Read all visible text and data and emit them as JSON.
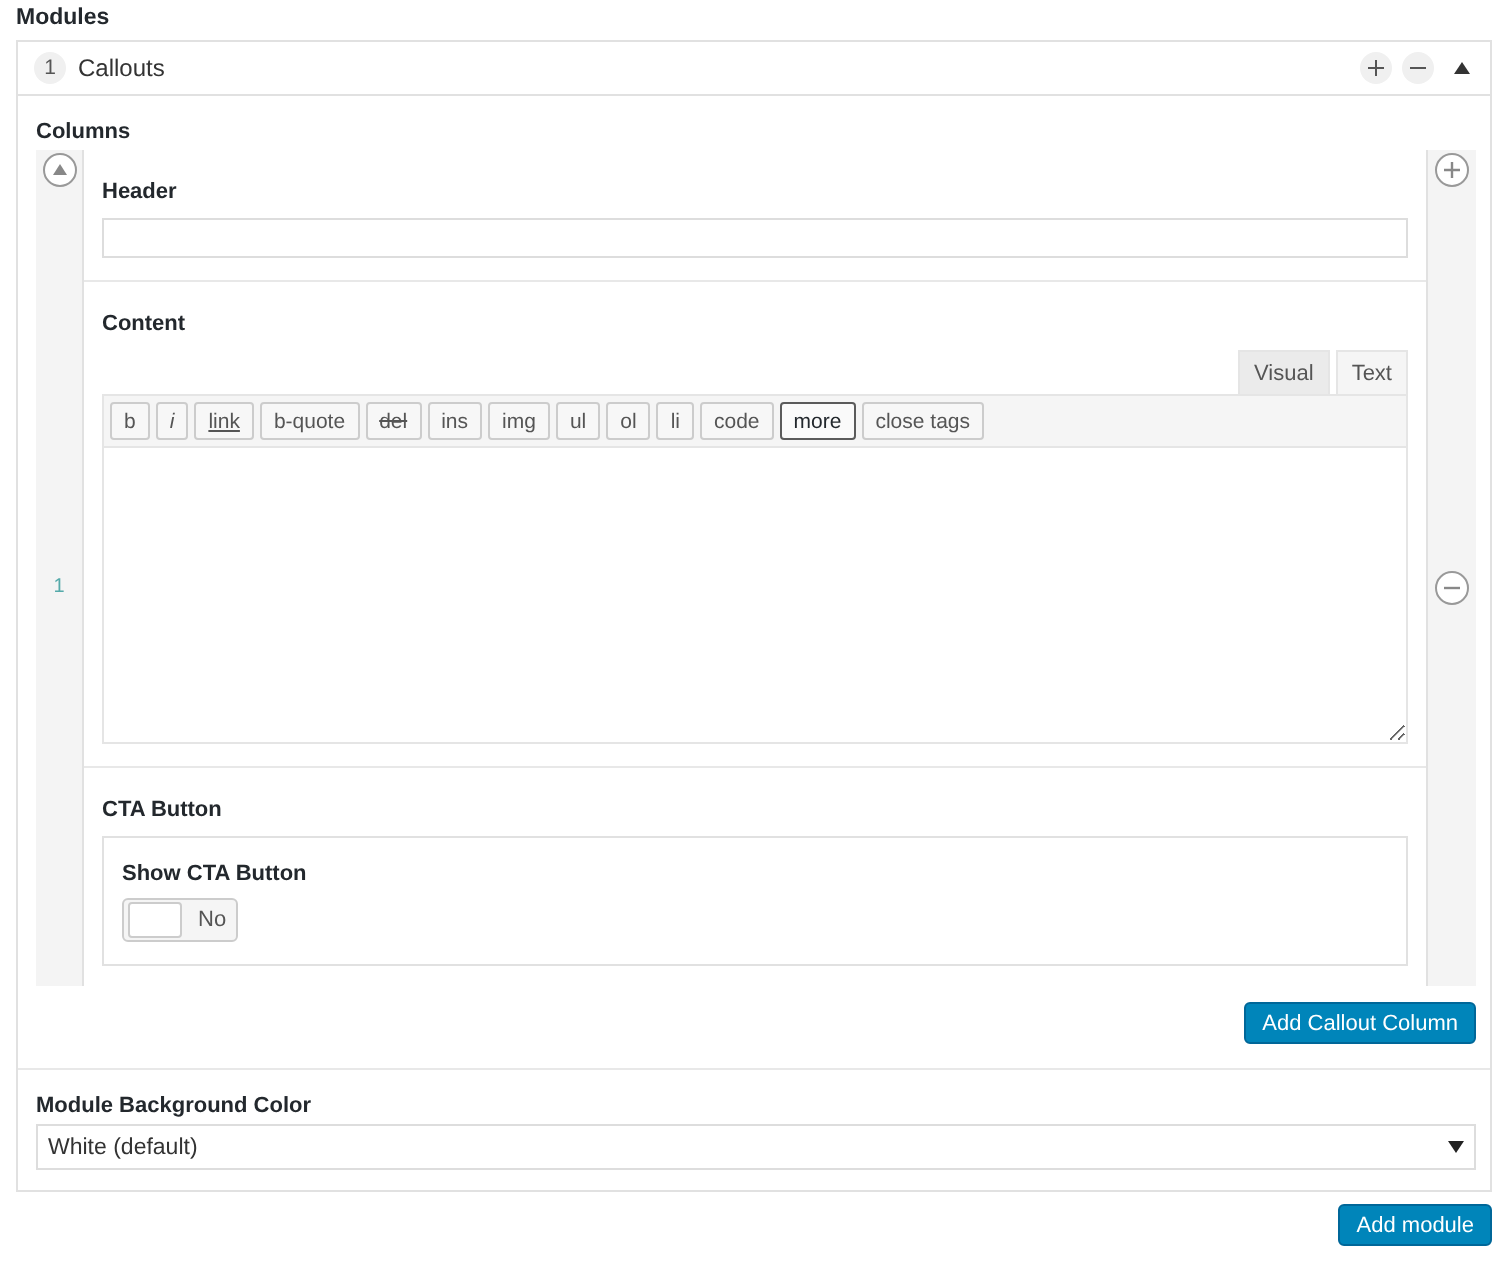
{
  "section_label": "Modules",
  "module": {
    "number": "1",
    "title": "Callouts",
    "expanded": true,
    "columns_label": "Columns",
    "rows": [
      {
        "number": "1",
        "fields": [
          {
            "kind": "text",
            "label": "Header"
          },
          {
            "kind": "editor",
            "label": "Content",
            "tabs": [
              {
                "label": "Visual",
                "selected": false
              },
              {
                "label": "Text",
                "selected": true
              }
            ],
            "buttons": [
              {
                "label": "b",
                "kind": "plain",
                "focused": false
              },
              {
                "label": "i",
                "kind": "italic",
                "focused": false
              },
              {
                "label": "link",
                "kind": "underline",
                "focused": false
              },
              {
                "label": "b-quote",
                "kind": "plain",
                "focused": false
              },
              {
                "label": "del",
                "kind": "strike",
                "focused": false
              },
              {
                "label": "ins",
                "kind": "plain",
                "focused": false
              },
              {
                "label": "img",
                "kind": "plain",
                "focused": false
              },
              {
                "label": "ul",
                "kind": "plain",
                "focused": false
              },
              {
                "label": "ol",
                "kind": "plain",
                "focused": false
              },
              {
                "label": "li",
                "kind": "plain",
                "focused": false
              },
              {
                "label": "code",
                "kind": "plain",
                "focused": false
              },
              {
                "label": "more",
                "kind": "plain",
                "focused": true
              },
              {
                "label": "close tags",
                "kind": "plain",
                "focused": false
              }
            ]
          },
          {
            "kind": "group",
            "label": "CTA Button",
            "fields": [
              {
                "kind": "toggle",
                "label": "Show CTA Button",
                "on": false,
                "state_label": "No"
              }
            ]
          }
        ]
      }
    ],
    "add_column_button": "Add Callout Column",
    "background": {
      "label": "Module Background Color",
      "value": "White (default)"
    }
  },
  "add_module_button": "Add module"
}
